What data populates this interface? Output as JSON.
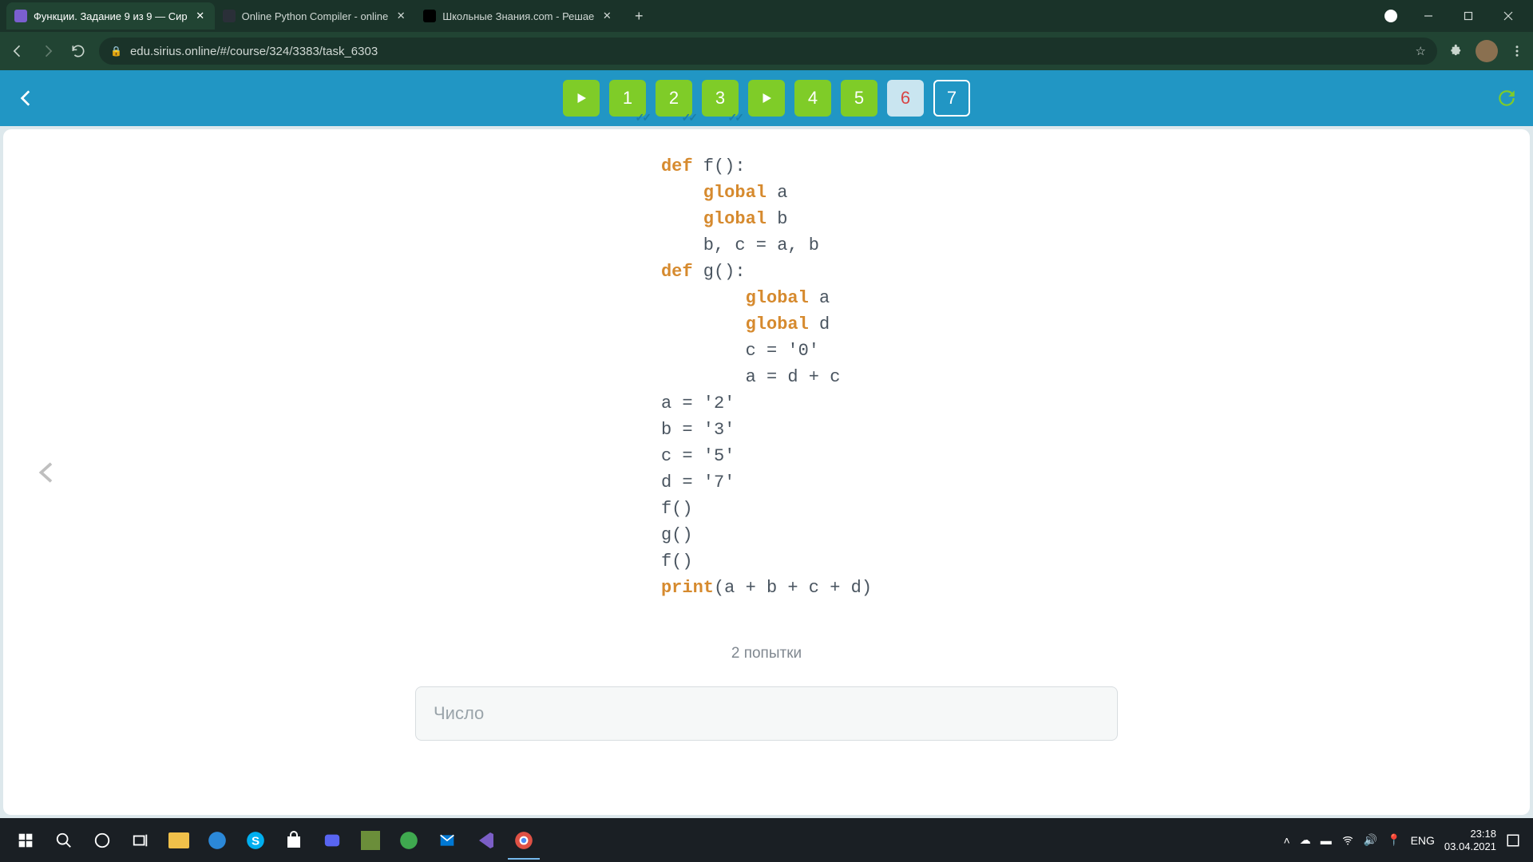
{
  "browser": {
    "tabs": [
      {
        "title": "Функции. Задание 9 из 9 — Сир",
        "active": true
      },
      {
        "title": "Online Python Compiler - online",
        "active": false
      },
      {
        "title": "Школьные Знания.com - Решае",
        "active": false
      }
    ],
    "url": "edu.sirius.online/#/course/324/3383/task_6303"
  },
  "nav": {
    "tasks": [
      {
        "type": "play"
      },
      {
        "label": "1",
        "state": "green",
        "checked": true
      },
      {
        "label": "2",
        "state": "green",
        "checked": true
      },
      {
        "label": "3",
        "state": "green",
        "checked": true
      },
      {
        "type": "play"
      },
      {
        "label": "4",
        "state": "green"
      },
      {
        "label": "5",
        "state": "green"
      },
      {
        "label": "6",
        "state": "red"
      },
      {
        "label": "7",
        "state": "current"
      }
    ]
  },
  "code": {
    "l1a": "def",
    "l1b": " f():",
    "l2a": "global",
    "l2b": " a",
    "l3a": "global",
    "l3b": " b",
    "l4": "b, c = a, b",
    "l5a": "def",
    "l5b": " g():",
    "l6a": "global",
    "l6b": " a",
    "l7a": "global",
    "l7b": " d",
    "l8": "c = '0'",
    "l9": "a = d + c",
    "l10": "a = '2'",
    "l11": "b = '3'",
    "l12": "c = '5'",
    "l13": "d = '7'",
    "l14": "f()",
    "l15": "g()",
    "l16": "f()",
    "l17a": "print",
    "l17b": "(a + b + c + d)"
  },
  "attempts_label": "2 попытки",
  "answer_placeholder": "Число",
  "taskbar": {
    "lang": "ENG",
    "time": "23:18",
    "date": "03.04.2021"
  }
}
